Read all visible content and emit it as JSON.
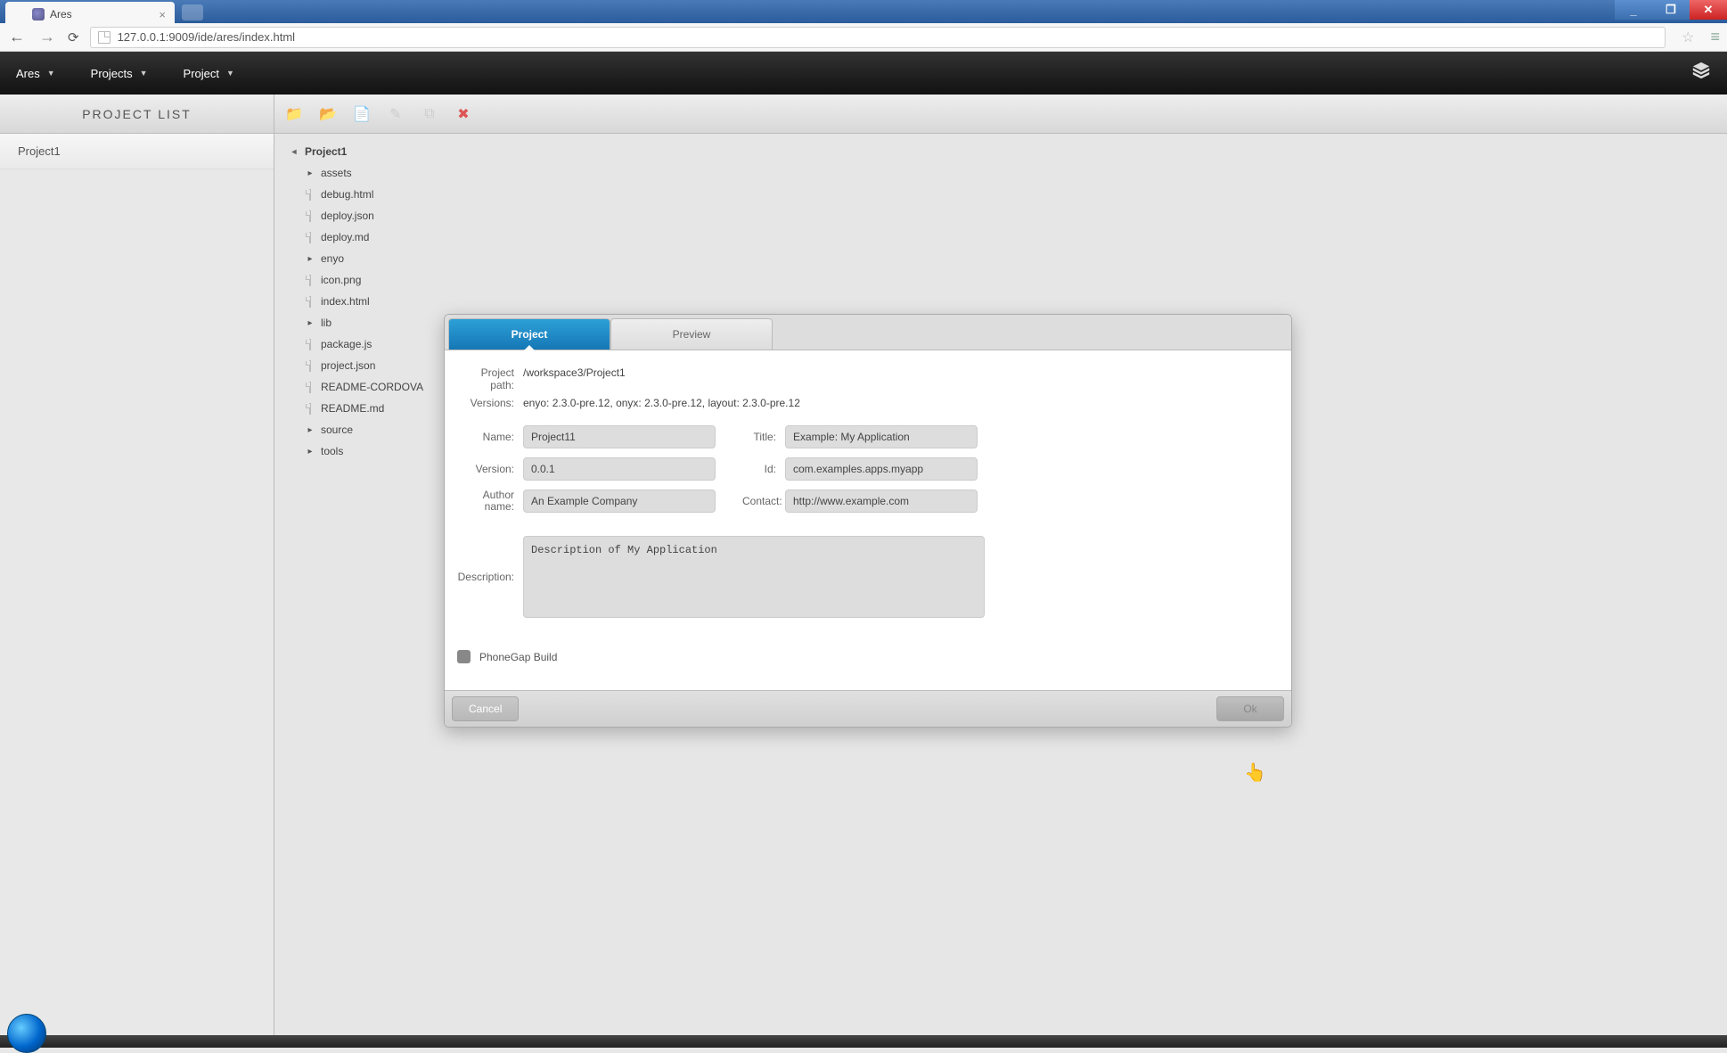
{
  "browser": {
    "tab_title": "Ares",
    "url": "127.0.0.1:9009/ide/ares/index.html"
  },
  "app_menu": {
    "items": [
      "Ares",
      "Projects",
      "Project"
    ]
  },
  "sidebar": {
    "header": "PROJECT LIST",
    "items": [
      "Project1"
    ]
  },
  "file_tree": {
    "root": "Project1",
    "children": [
      {
        "name": "assets",
        "type": "folder"
      },
      {
        "name": "debug.html",
        "type": "file"
      },
      {
        "name": "deploy.json",
        "type": "file"
      },
      {
        "name": "deploy.md",
        "type": "file"
      },
      {
        "name": "enyo",
        "type": "folder"
      },
      {
        "name": "icon.png",
        "type": "file"
      },
      {
        "name": "index.html",
        "type": "file"
      },
      {
        "name": "lib",
        "type": "folder"
      },
      {
        "name": "package.js",
        "type": "file"
      },
      {
        "name": "project.json",
        "type": "file"
      },
      {
        "name": "README-CORDOVA",
        "type": "file"
      },
      {
        "name": "README.md",
        "type": "file"
      },
      {
        "name": "source",
        "type": "folder"
      },
      {
        "name": "tools",
        "type": "folder"
      }
    ]
  },
  "modal": {
    "tabs": {
      "project": "Project",
      "preview": "Preview"
    },
    "project_path_label": "Project path:",
    "project_path_value": "/workspace3/Project1",
    "versions_label": "Versions:",
    "versions_value": "enyo: 2.3.0-pre.12, onyx: 2.3.0-pre.12, layout: 2.3.0-pre.12",
    "labels": {
      "name": "Name:",
      "version": "Version:",
      "author": "Author name:",
      "title": "Title:",
      "id": "Id:",
      "contact": "Contact:",
      "description": "Description:",
      "phonegap": "PhoneGap Build"
    },
    "values": {
      "name": "Project11",
      "version": "0.0.1",
      "author": "An Example Company",
      "title": "Example: My Application",
      "id": "com.examples.apps.myapp",
      "contact": "http://www.example.com",
      "description": "Description of My Application"
    },
    "buttons": {
      "cancel": "Cancel",
      "ok": "Ok"
    }
  }
}
